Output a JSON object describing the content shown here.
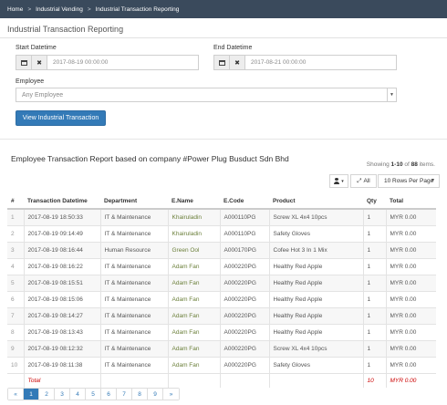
{
  "breadcrumb": {
    "home": "Home",
    "sep": ">",
    "level1": "Industrial Vending",
    "level2": "Industrial Transaction Reporting"
  },
  "page_title": "Industrial Transaction Reporting",
  "form": {
    "start_label": "Start Datetime",
    "start_value": "2017-08-19 00:00:00",
    "end_label": "End Datetime",
    "end_value": "2017-08-21 00:00:00",
    "employee_label": "Employee",
    "employee_value": "Any Employee",
    "submit_label": "View Industrial Transaction"
  },
  "report": {
    "heading": "Employee Transaction Report based on company #Power Plug Busduct Sdn Bhd",
    "showing_prefix": "Showing",
    "showing_range": "1-10",
    "showing_of": "of",
    "showing_total": "88",
    "showing_suffix": "items.",
    "all_label": "All",
    "rows_per_page": "10 Rows Per Page"
  },
  "table": {
    "columns": [
      "#",
      "Transaction Datetime",
      "Department",
      "E.Name",
      "E.Code",
      "Product",
      "Qty",
      "Total"
    ],
    "rows": [
      [
        "1",
        "2017-08-19 18:50:33",
        "IT & Maintenance",
        "Khairuladin",
        "A000110PG",
        "Screw XL 4x4 10pcs",
        "1",
        "MYR 0.00"
      ],
      [
        "2",
        "2017-08-19 09:14:49",
        "IT & Maintenance",
        "Khairuladin",
        "A000110PG",
        "Safety Gloves",
        "1",
        "MYR 0.00"
      ],
      [
        "3",
        "2017-08-19 08:16:44",
        "Human Resource",
        "Green Ool",
        "A000170PG",
        "Cofee Hot 3 In 1 Mix",
        "1",
        "MYR 0.00"
      ],
      [
        "4",
        "2017-08-19 08:16:22",
        "IT & Maintenance",
        "Adam Fan",
        "A000220PG",
        "Healthy Red Apple",
        "1",
        "MYR 0.00"
      ],
      [
        "5",
        "2017-08-19 08:15:51",
        "IT & Maintenance",
        "Adam Fan",
        "A000220PG",
        "Healthy Red Apple",
        "1",
        "MYR 0.00"
      ],
      [
        "6",
        "2017-08-19 08:15:06",
        "IT & Maintenance",
        "Adam Fan",
        "A000220PG",
        "Healthy Red Apple",
        "1",
        "MYR 0.00"
      ],
      [
        "7",
        "2017-08-19 08:14:27",
        "IT & Maintenance",
        "Adam Fan",
        "A000220PG",
        "Healthy Red Apple",
        "1",
        "MYR 0.00"
      ],
      [
        "8",
        "2017-08-19 08:13:43",
        "IT & Maintenance",
        "Adam Fan",
        "A000220PG",
        "Healthy Red Apple",
        "1",
        "MYR 0.00"
      ],
      [
        "9",
        "2017-08-19 08:12:32",
        "IT & Maintenance",
        "Adam Fan",
        "A000220PG",
        "Screw XL 4x4 10pcs",
        "1",
        "MYR 0.00"
      ],
      [
        "10",
        "2017-08-19 08:11:38",
        "IT & Maintenance",
        "Adam Fan",
        "A000220PG",
        "Safety Gloves",
        "1",
        "MYR 0.00"
      ]
    ],
    "total": {
      "label": "Total",
      "qty": "10",
      "amount": "MYR 0.00"
    }
  },
  "pagination": {
    "prev": "«",
    "pages": [
      "1",
      "2",
      "3",
      "4",
      "5",
      "6",
      "7",
      "8",
      "9"
    ],
    "next": "»",
    "active": "1"
  },
  "colors": {
    "breadcrumb_bg": "#3a4a5c",
    "primary": "#337ab7",
    "total_text": "#cc0000"
  }
}
